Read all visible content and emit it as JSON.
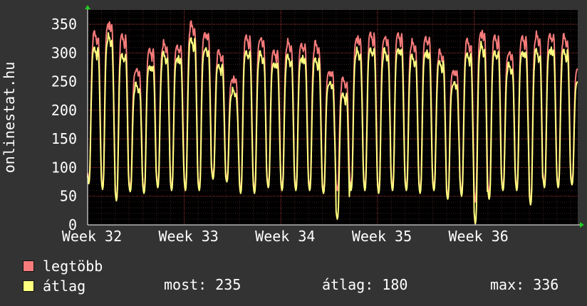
{
  "chart_data": {
    "type": "line",
    "ylabel": "onlinestat.hu",
    "ylim": [
      0,
      375
    ],
    "yticks": [
      0,
      50,
      100,
      150,
      200,
      250,
      300,
      350
    ],
    "xtick_labels": [
      "Week 32",
      "Week 33",
      "Week 34",
      "Week 35",
      "Week 36"
    ],
    "days": 35.5,
    "series": [
      {
        "name": "legtöbb",
        "color": "#f77b7b",
        "daily_max": [
          336,
          355,
          332,
          273,
          308,
          318,
          315,
          352,
          338,
          303,
          258,
          330,
          328,
          305,
          320,
          318,
          318,
          270,
          255,
          330,
          335,
          330,
          335,
          320,
          330,
          303,
          272,
          323,
          340,
          330,
          303,
          330,
          333,
          335,
          330,
          275
        ],
        "daily_min": [
          75,
          65,
          45,
          65,
          60,
          70,
          65,
          65,
          65,
          85,
          80,
          60,
          60,
          70,
          65,
          65,
          65,
          60,
          60,
          65,
          65,
          60,
          65,
          65,
          60,
          65,
          50,
          55,
          40,
          55,
          65,
          65,
          40,
          70,
          70,
          75
        ]
      },
      {
        "name": "átlag",
        "color": "#ffff80",
        "daily_max": [
          310,
          330,
          300,
          245,
          280,
          300,
          295,
          325,
          310,
          280,
          235,
          305,
          300,
          285,
          295,
          295,
          290,
          250,
          230,
          305,
          310,
          305,
          310,
          295,
          305,
          285,
          250,
          300,
          315,
          305,
          280,
          305,
          305,
          310,
          305,
          255
        ],
        "daily_min": [
          72,
          62,
          42,
          58,
          55,
          65,
          60,
          60,
          60,
          80,
          75,
          55,
          55,
          65,
          60,
          60,
          60,
          55,
          10,
          60,
          60,
          55,
          60,
          60,
          55,
          60,
          45,
          50,
          2,
          45,
          60,
          60,
          35,
          65,
          65,
          70
        ]
      }
    ],
    "grid": true
  },
  "legend": {
    "max_label": "legtöbb",
    "avg_label": "átlag"
  },
  "stats": {
    "now": "most: 235",
    "avg": "átlag: 180",
    "max": "max: 336"
  },
  "colors": {
    "background": "#333333",
    "plot_background": "#000000",
    "grid_minor": "#3a2020",
    "grid_major": "#8a2828",
    "axis_arrow": "#22cc22"
  }
}
